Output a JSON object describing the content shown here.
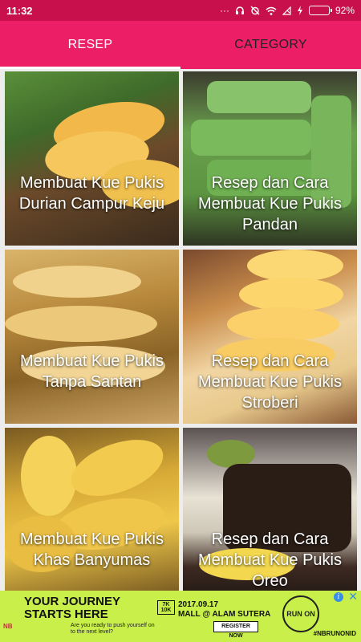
{
  "status_bar": {
    "time": "11:32",
    "battery": "92%",
    "battery_level": 0.92
  },
  "tabs": [
    {
      "label": "RESEP",
      "active": true
    },
    {
      "label": "CATEGORY",
      "active": false
    }
  ],
  "recipes": [
    {
      "title": "Membuat Kue Pukis Durian Campur Keju"
    },
    {
      "title": "Resep dan Cara Membuat Kue Pukis Pandan"
    },
    {
      "title": "Membuat Kue Pukis Tanpa Santan"
    },
    {
      "title": "Resep dan Cara Membuat Kue Pukis Stroberi"
    },
    {
      "title": "Membuat Kue Pukis Khas Banyumas"
    },
    {
      "title": "Resep dan Cara Membuat Kue Pukis Oreo"
    }
  ],
  "ad": {
    "headline": "YOUR JOURNEY STARTS HERE",
    "subtext": "Are you ready to push yourself on to the next level?",
    "badge": "7K 10K",
    "date": "2017.09.17",
    "venue": "MALL @ ALAM SUTERA",
    "register": "REGISTER NOW",
    "runon": "RUN ON",
    "hashtag": "#NBRUNONID",
    "brand": "NB",
    "close": "✕",
    "info": "i"
  },
  "colors": {
    "status_bar": "#c8104d",
    "tab_bar": "#ec1f66",
    "ad_background": "#c9f04a"
  }
}
